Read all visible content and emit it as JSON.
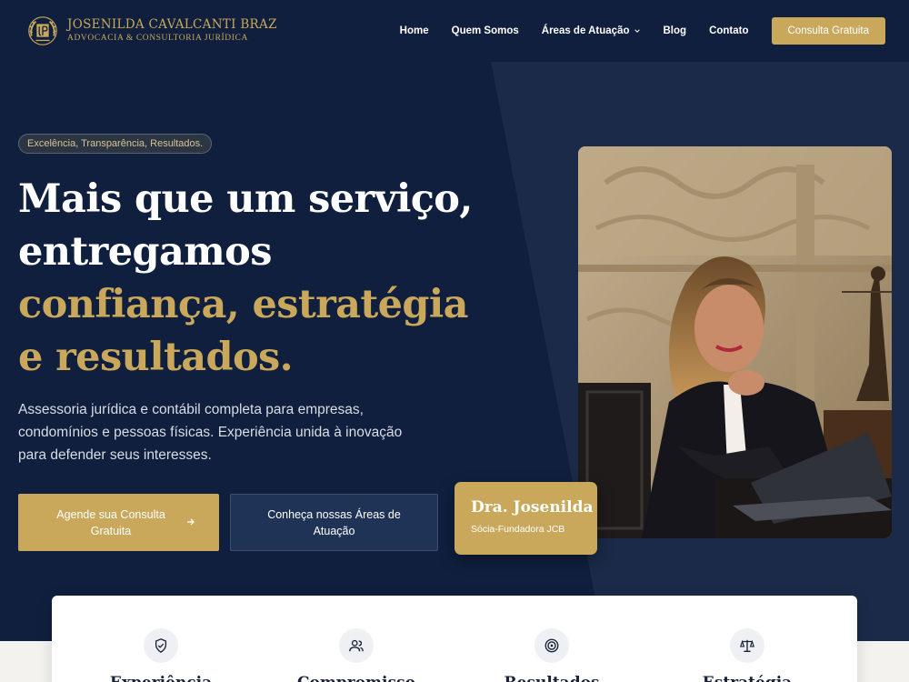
{
  "brand": {
    "name": "JOSENILDA CAVALCANTI BRAZ",
    "tagline": "ADVOCACIA & CONSULTORIA JURÍDICA"
  },
  "nav": {
    "items": [
      "Home",
      "Quem Somos",
      "Áreas de Atuação",
      "Blog",
      "Contato"
    ],
    "cta": "Consulta Gratuita"
  },
  "hero": {
    "badge": "Excelência, Transparência, Resultados.",
    "headline": {
      "line1": "Mais que um serviço,",
      "line2": "entregamos",
      "line3": "confiança, estratégia",
      "line4": "e resultados."
    },
    "lead": "Assessoria jurídica e contábil completa para empresas, condomínios e pessoas físicas. Experiência unida à inovação para defender seus interesses.",
    "primary_button": "Agende sua Consulta Gratuita",
    "secondary_button": "Conheça nossas Áreas de Atuação",
    "nameplate": {
      "name": "Dra. Josenilda",
      "role": "Sócia-Fundadora JCB"
    }
  },
  "features": [
    {
      "title": "Experiência",
      "icon": "shield-check-icon"
    },
    {
      "title": "Compromisso",
      "icon": "users-icon"
    },
    {
      "title": "Resultados",
      "icon": "target-icon"
    },
    {
      "title": "Estratégia",
      "icon": "scales-icon"
    }
  ],
  "colors": {
    "navy": "#0f1f3d",
    "gold": "#c9a85c"
  }
}
